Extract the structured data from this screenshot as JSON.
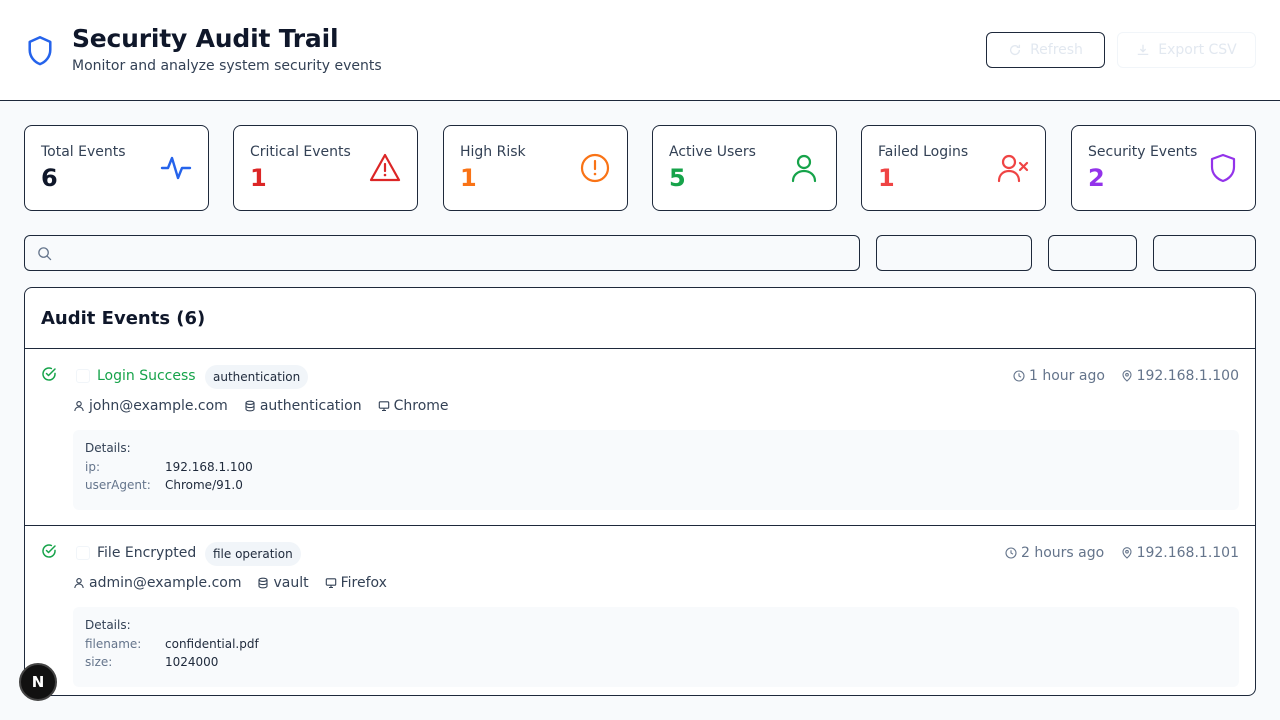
{
  "header": {
    "title": "Security Audit Trail",
    "subtitle": "Monitor and analyze system security events",
    "refresh_label": "Refresh",
    "export_label": "Export CSV"
  },
  "stats": [
    {
      "label": "Total Events",
      "value": "6",
      "color": "#0f172a",
      "icon": "activity-icon",
      "icon_color": "#2563eb"
    },
    {
      "label": "Critical Events",
      "value": "1",
      "color": "#dc2626",
      "icon": "warning-triangle-icon",
      "icon_color": "#dc2626"
    },
    {
      "label": "High Risk",
      "value": "1",
      "color": "#f97316",
      "icon": "alert-circle-icon",
      "icon_color": "#f97316"
    },
    {
      "label": "Active Users",
      "value": "5",
      "color": "#16a34a",
      "icon": "user-icon",
      "icon_color": "#16a34a"
    },
    {
      "label": "Failed Logins",
      "value": "1",
      "color": "#ef4444",
      "icon": "user-x-icon",
      "icon_color": "#ef4444"
    },
    {
      "label": "Security Events",
      "value": "2",
      "color": "#9333ea",
      "icon": "shield-icon",
      "icon_color": "#9333ea"
    }
  ],
  "search": {
    "placeholder": ""
  },
  "panel": {
    "title": "Audit Events (6)"
  },
  "events": [
    {
      "title": "Login Success",
      "title_color": "#16a34a",
      "category": "authentication",
      "time": "1 hour ago",
      "ip": "192.168.1.100",
      "user": "john@example.com",
      "resource": "authentication",
      "client": "Chrome",
      "details_label": "Details:",
      "details": [
        {
          "key": "ip:",
          "value": "192.168.1.100"
        },
        {
          "key": "userAgent:",
          "value": "Chrome/91.0"
        }
      ]
    },
    {
      "title": "File Encrypted",
      "title_color": "#334155",
      "category": "file operation",
      "time": "2 hours ago",
      "ip": "192.168.1.101",
      "user": "admin@example.com",
      "resource": "vault",
      "client": "Firefox",
      "details_label": "Details:",
      "details": [
        {
          "key": "filename:",
          "value": "confidential.pdf"
        },
        {
          "key": "size:",
          "value": "1024000"
        }
      ]
    }
  ],
  "dev_badge": "N"
}
